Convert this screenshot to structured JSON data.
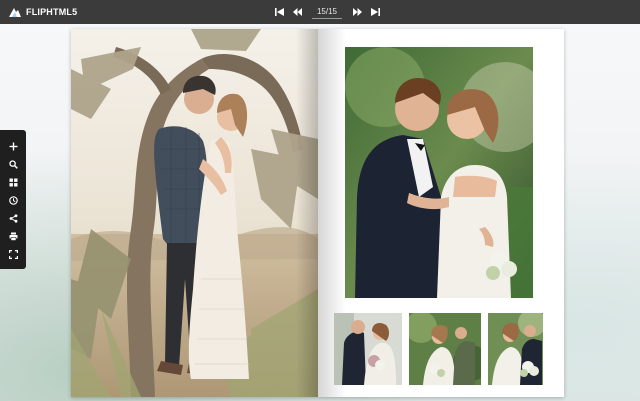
{
  "app": {
    "logo_text": "FLIPHTML5",
    "logo_icon": "fliphtml5-logo-icon"
  },
  "toolbar": {
    "first_page_icon": "skip-first-icon",
    "prev_page_icon": "rewind-icon",
    "page_indicator": "15/15",
    "next_page_icon": "fast-forward-icon",
    "last_page_icon": "skip-last-icon"
  },
  "sidebar": {
    "items": [
      {
        "name": "zoom-in",
        "icon": "plus-icon"
      },
      {
        "name": "search",
        "icon": "search-icon"
      },
      {
        "name": "thumbnails",
        "icon": "grid-icon"
      },
      {
        "name": "autoflip",
        "icon": "clock-icon"
      },
      {
        "name": "share",
        "icon": "share-icon"
      },
      {
        "name": "print",
        "icon": "print-icon"
      },
      {
        "name": "fullscreen",
        "icon": "fullscreen-icon"
      }
    ]
  },
  "colors": {
    "topbar": "#3b3b3b",
    "sidebar": "#1f1f1f",
    "page_bg": "#ffffff",
    "icon": "#ffffff"
  }
}
